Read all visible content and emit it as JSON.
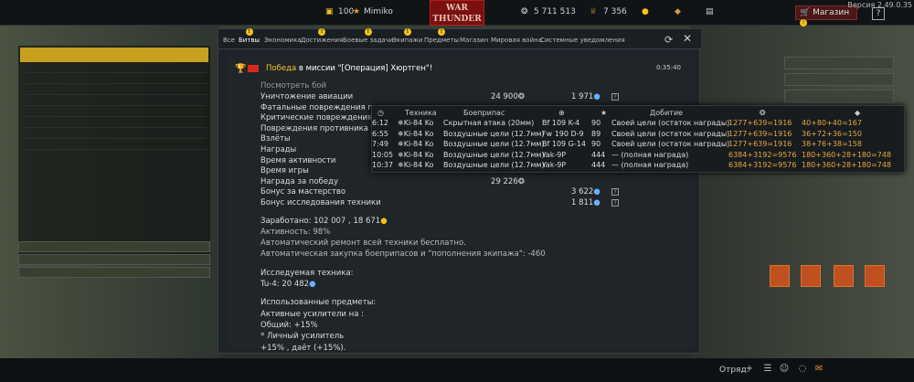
{
  "topbar": {
    "level": "100",
    "username": "Mimiko",
    "logo_top": "WAR",
    "logo_bottom": "THUNDER",
    "silver_lions": "5 711 513",
    "research_points": "7 356",
    "shop_label": "Магазин",
    "help": "?",
    "version": "Версия 2.49.0.35"
  },
  "tabs": [
    {
      "label": "Все",
      "alert": false
    },
    {
      "label": "Битвы",
      "alert": true
    },
    {
      "label": "Экономика",
      "alert": false
    },
    {
      "label": "Достижения",
      "alert": true
    },
    {
      "label": "Боевые задачи",
      "alert": true
    },
    {
      "label": "Экипажи",
      "alert": true
    },
    {
      "label": "Предметы",
      "alert": true
    },
    {
      "label": "Магазин",
      "alert": false
    },
    {
      "label": "Мировая война",
      "alert": false
    },
    {
      "label": "Системные уведомления",
      "alert": false
    }
  ],
  "message": {
    "title_win": "Победа",
    "title_rest": " в миссии \"[Операция] Хюртген\"!",
    "time": "0:35:40",
    "view_battle": "Посмотреть бой",
    "stats": [
      {
        "label": "Уничтожение авиации",
        "v1": "24 900",
        "v2": "1 971",
        "help": true
      },
      {
        "label": "Фатальные повреждения проти",
        "v1": "",
        "v2": "",
        "help": false
      },
      {
        "label": "Критические повреждения про",
        "v1": "",
        "v2": "",
        "help": false
      },
      {
        "label": "Повреждения противника",
        "v1": "",
        "v2": "",
        "help": false
      },
      {
        "label": "Взлёты",
        "v1": "",
        "v2": "",
        "help": false
      },
      {
        "label": "Награды",
        "v1": "",
        "v2": "",
        "help": false
      },
      {
        "label": "Время активности",
        "v1": "",
        "v2": "",
        "help": false
      },
      {
        "label": "Время игры",
        "v1": "",
        "v2": "",
        "help": false
      },
      {
        "label": "Награда за победу",
        "v1": "29 226",
        "v2": "",
        "help": false
      },
      {
        "label": "Бонус за мастерство",
        "v1": "",
        "v2": "3 622",
        "help": true
      },
      {
        "label": "Бонус исследования техники",
        "v1": "",
        "v2": "1 811",
        "help": true
      }
    ],
    "earned": "Заработано: 102 007 , 18 671",
    "activity": "Активность: 98%",
    "repair": "Автоматический ремонт всей техники бесплатно.",
    "ammo": "Автоматическая закупка боеприпасов и \"пополнения экипажа\": -460",
    "research_title": "Исследуемая техника:",
    "research_vehicle": "Tu-4: 20 482",
    "items_title": "Использованные предметы:",
    "boosters": "Активные усилители на :",
    "total": "Общий: +15%",
    "personal": "* Личный усилитель",
    "personal_val": "+15% , даёт (+15%)."
  },
  "popup": {
    "headers": {
      "time": "◷",
      "tech": "Техника",
      "ammo": "Боеприпас",
      "target": "⊕",
      "score": "★",
      "finish": "Добитие",
      "silver": "❂",
      "rp": "◆"
    },
    "rows": [
      {
        "time": "6:12",
        "tech": "Ki-84 Ko",
        "ammo": "Скрытная атака (20мм)",
        "target": "Bf 109 K-4",
        "pts": "90",
        "fin": "Своей цели (остаток награды)",
        "silver": "1277+639=1916",
        "rp": "40+80+40=167"
      },
      {
        "time": "6:55",
        "tech": "Ki-84 Ko",
        "ammo": "Воздушные цели (12.7мм)",
        "target": "Fw 190 D-9",
        "pts": "89",
        "fin": "Своей цели (остаток награды)",
        "silver": "1277+639=1916",
        "rp": "36+72+36=150"
      },
      {
        "time": "7:49",
        "tech": "Ki-84 Ko",
        "ammo": "Воздушные цели (12.7мм)",
        "target": "Bf 109 G-14",
        "pts": "90",
        "fin": "Своей цели (остаток награды)",
        "silver": "1277+639=1916",
        "rp": "38+76+38=158"
      },
      {
        "time": "10:05",
        "tech": "Ki-84 Ko",
        "ammo": "Воздушные цели (12.7мм)",
        "target": "Yak-9P",
        "pts": "444",
        "fin": "— (полная награда)",
        "silver": "6384+3192=9576",
        "rp": "180+360+28+180=748"
      },
      {
        "time": "10:37",
        "tech": "Ki-84 Ko",
        "ammo": "Воздушные цели (12.7мм)",
        "target": "Yak-9P",
        "pts": "444",
        "fin": "— (полная награда)",
        "silver": "6384+3192=9576",
        "rp": "180+360+28+180=748"
      }
    ]
  },
  "bottombar": {
    "squad_label": "Отряд:"
  },
  "colors": {
    "win": "#f3c625",
    "alert": "#f2c418",
    "window_bg": "#1d2327",
    "logo_red": "#7a1010"
  }
}
